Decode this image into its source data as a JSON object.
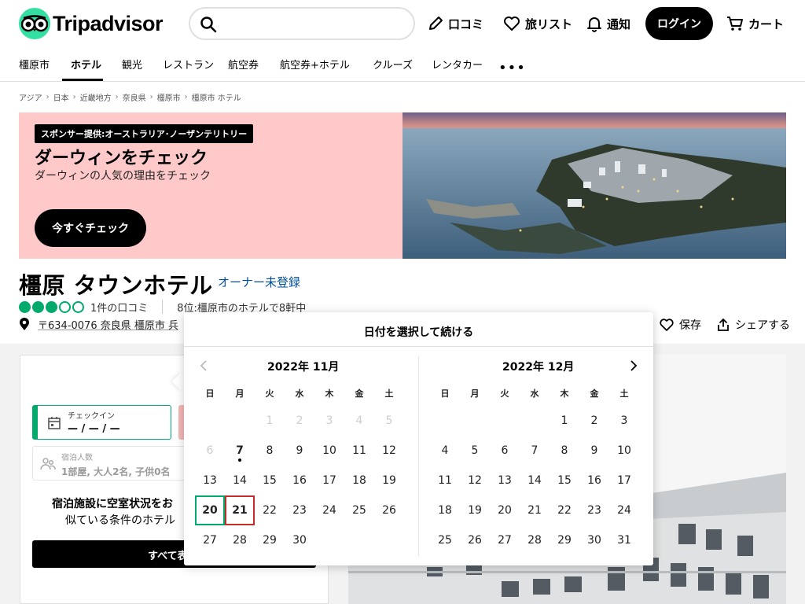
{
  "header": {
    "logo_text": "Tripadvisor",
    "search_placeholder": "",
    "nav": {
      "reviews": "口コミ",
      "trips": "旅リスト",
      "alerts": "通知",
      "login": "ログイン",
      "cart": "カート"
    }
  },
  "subnav": {
    "items": [
      "橿原市",
      "ホテル",
      "観光",
      "レストラン",
      "航空券",
      "航空券+ホテル",
      "クルーズ",
      "レンタカー"
    ],
    "active_index": 1,
    "more": "•••"
  },
  "breadcrumb": [
    "アジア",
    "日本",
    "近畿地方",
    "奈良県",
    "橿原市",
    "橿原市 ホテル"
  ],
  "banner": {
    "sponsor_tag": "スポンサー提供:オーストラリア･ノーザンテリトリー",
    "title": "ダーウィンをチェック",
    "subtitle": "ダーウィンの人気の理由をチェック",
    "button": "今すぐチェック"
  },
  "hotel": {
    "name": "橿原 タウンホテル",
    "owner_link": "オーナー未登録",
    "rating": 3,
    "rating_max": 5,
    "review_count": "1件の口コミ",
    "rank": "8位:橿原市のホテルで8軒中",
    "address": "〒634-0076 奈良県 橿原市 兵",
    "save": "保存",
    "share": "シェアする"
  },
  "availability": {
    "checkin_label": "チェックイン",
    "checkin_value": "— / — / —",
    "guests_label": "宿泊人数",
    "guests_value": "1部屋, 大人2名, 子供0名",
    "text_line1": "宿泊施設に空室状況をお",
    "text_line2": "似ている条件のホテル",
    "button": "すべて表"
  },
  "calendar": {
    "title": "日付を選択して続ける",
    "weekdays": [
      "日",
      "月",
      "火",
      "水",
      "木",
      "金",
      "土"
    ],
    "months": [
      {
        "label": "2022年 11月",
        "offset": 2,
        "days": 30,
        "disabled_through": 6,
        "today": 7,
        "checkin": 20,
        "checkout": 21
      },
      {
        "label": "2022年 12月",
        "offset": 4,
        "days": 31,
        "disabled_through": 0,
        "today": 0,
        "checkin": 0,
        "checkout": 0
      }
    ]
  },
  "colors": {
    "brand_green": "#34e0a1",
    "rating_green": "#00aa6c",
    "banner_pink": "#ffc9c9",
    "link_blue": "#004f9f",
    "checkout_red": "#c42b2b"
  }
}
